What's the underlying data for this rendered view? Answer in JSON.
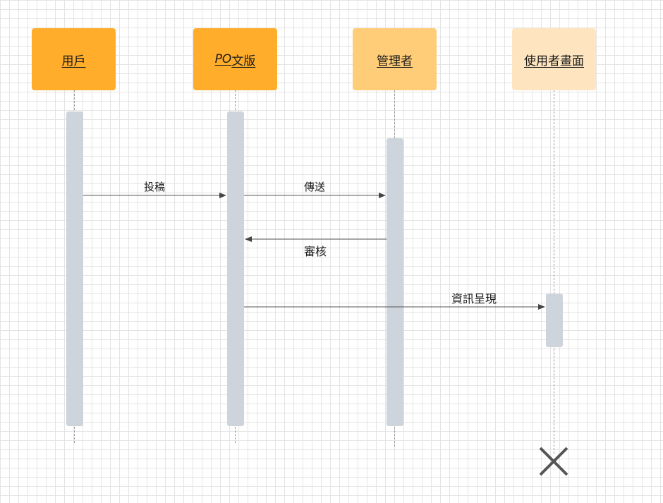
{
  "diagram": {
    "participants": [
      {
        "id": "user",
        "label": "用戶",
        "color": "#ffad2b"
      },
      {
        "id": "po",
        "label_prefix": "PO",
        "label_suffix": "文版",
        "color": "#ffad2b"
      },
      {
        "id": "admin",
        "label": "管理者",
        "color": "#ffcd78"
      },
      {
        "id": "screen",
        "label": "使用者畫面",
        "color": "#ffe5bf"
      }
    ],
    "messages": [
      {
        "from": "user",
        "to": "po",
        "label": "投稿"
      },
      {
        "from": "po",
        "to": "admin",
        "label": "傳送"
      },
      {
        "from": "admin",
        "to": "po",
        "label": "審核"
      },
      {
        "from": "po",
        "to": "screen",
        "label": "資訊呈現"
      }
    ],
    "destroy": {
      "participant": "screen",
      "symbol": "✕"
    },
    "colors": {
      "activation": "#ced4db",
      "lifeline": "#999999",
      "arrow": "#555555",
      "grid": "#e4e4e4"
    }
  }
}
